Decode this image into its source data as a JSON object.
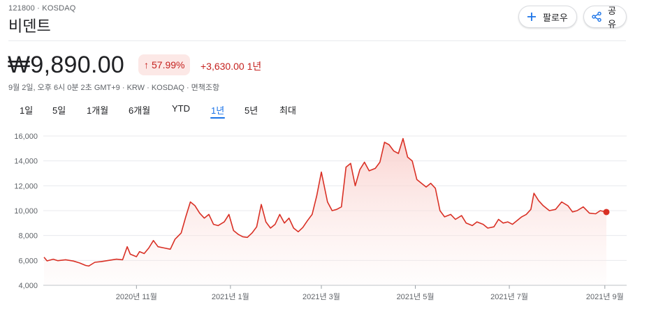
{
  "header": {
    "ticker": "121800 · KOSDAQ",
    "name": "비덴트",
    "follow_label": "팔로우",
    "share_label": "공유",
    "follow_icon": "plus-icon",
    "share_icon": "share-icon"
  },
  "quote": {
    "price": "₩9,890.00",
    "pct_change": "57.99%",
    "abs_change": "+3,630.00",
    "period": "1년",
    "meta": "9월 2일, 오후 6시 0분 2초 GMT+9 · KRW · KOSDAQ · 면책조항"
  },
  "tabs": [
    {
      "label": "1일",
      "active": false
    },
    {
      "label": "5일",
      "active": false
    },
    {
      "label": "1개월",
      "active": false
    },
    {
      "label": "6개월",
      "active": false
    },
    {
      "label": "YTD",
      "active": false
    },
    {
      "label": "1년",
      "active": true
    },
    {
      "label": "5년",
      "active": false
    },
    {
      "label": "최대",
      "active": false
    }
  ],
  "colors": {
    "line": "#d93025",
    "fill_top": "#fad2cf",
    "negative": "#c5221f",
    "accent": "#1a73e8",
    "grid": "#e8eaed"
  },
  "chart_data": {
    "type": "area",
    "title": "",
    "xlabel": "",
    "ylabel": "",
    "ylim": [
      4000,
      16000
    ],
    "yticks": [
      4000,
      6000,
      8000,
      10000,
      12000,
      14000,
      16000
    ],
    "ytick_labels": [
      "4,000",
      "6,000",
      "8,000",
      "10,000",
      "12,000",
      "14,000",
      "16,000"
    ],
    "xlim": [
      "2020-09-02",
      "2021-09-02"
    ],
    "xticks": [
      {
        "date": "2020-11-01",
        "label": "2020년 11월"
      },
      {
        "date": "2021-01-01",
        "label": "2021년 1월"
      },
      {
        "date": "2021-03-01",
        "label": "2021년 3월"
      },
      {
        "date": "2021-05-01",
        "label": "2021년 5월"
      },
      {
        "date": "2021-07-01",
        "label": "2021년 7월"
      },
      {
        "date": "2021-09-01",
        "label": "2021년 9월"
      }
    ],
    "grid": "horizontal",
    "series": [
      {
        "values": [
          {
            "x": "2020-09-02",
            "y": 6260
          },
          {
            "x": "2020-09-04",
            "y": 5960
          },
          {
            "x": "2020-09-08",
            "y": 6100
          },
          {
            "x": "2020-09-11",
            "y": 5980
          },
          {
            "x": "2020-09-16",
            "y": 6050
          },
          {
            "x": "2020-09-21",
            "y": 5950
          },
          {
            "x": "2020-09-25",
            "y": 5800
          },
          {
            "x": "2020-09-29",
            "y": 5600
          },
          {
            "x": "2020-10-01",
            "y": 5550
          },
          {
            "x": "2020-10-05",
            "y": 5850
          },
          {
            "x": "2020-10-09",
            "y": 5900
          },
          {
            "x": "2020-10-14",
            "y": 6000
          },
          {
            "x": "2020-10-19",
            "y": 6100
          },
          {
            "x": "2020-10-23",
            "y": 6050
          },
          {
            "x": "2020-10-26",
            "y": 7100
          },
          {
            "x": "2020-10-28",
            "y": 6500
          },
          {
            "x": "2020-11-01",
            "y": 6300
          },
          {
            "x": "2020-11-03",
            "y": 6700
          },
          {
            "x": "2020-11-06",
            "y": 6550
          },
          {
            "x": "2020-11-09",
            "y": 7000
          },
          {
            "x": "2020-11-12",
            "y": 7600
          },
          {
            "x": "2020-11-15",
            "y": 7100
          },
          {
            "x": "2020-11-19",
            "y": 7000
          },
          {
            "x": "2020-11-23",
            "y": 6900
          },
          {
            "x": "2020-11-26",
            "y": 7700
          },
          {
            "x": "2020-11-30",
            "y": 8200
          },
          {
            "x": "2020-12-03",
            "y": 9500
          },
          {
            "x": "2020-12-06",
            "y": 10700
          },
          {
            "x": "2020-12-09",
            "y": 10400
          },
          {
            "x": "2020-12-12",
            "y": 9800
          },
          {
            "x": "2020-12-15",
            "y": 9400
          },
          {
            "x": "2020-12-18",
            "y": 9700
          },
          {
            "x": "2020-12-21",
            "y": 8900
          },
          {
            "x": "2020-12-24",
            "y": 8800
          },
          {
            "x": "2020-12-28",
            "y": 9100
          },
          {
            "x": "2020-12-31",
            "y": 9700
          },
          {
            "x": "2021-01-03",
            "y": 8400
          },
          {
            "x": "2021-01-06",
            "y": 8100
          },
          {
            "x": "2021-01-09",
            "y": 7900
          },
          {
            "x": "2021-01-12",
            "y": 7850
          },
          {
            "x": "2021-01-15",
            "y": 8200
          },
          {
            "x": "2021-01-18",
            "y": 8700
          },
          {
            "x": "2021-01-21",
            "y": 10500
          },
          {
            "x": "2021-01-24",
            "y": 9100
          },
          {
            "x": "2021-01-27",
            "y": 8600
          },
          {
            "x": "2021-01-30",
            "y": 8900
          },
          {
            "x": "2021-02-02",
            "y": 9700
          },
          {
            "x": "2021-02-05",
            "y": 9000
          },
          {
            "x": "2021-02-08",
            "y": 9400
          },
          {
            "x": "2021-02-11",
            "y": 8600
          },
          {
            "x": "2021-02-14",
            "y": 8300
          },
          {
            "x": "2021-02-17",
            "y": 8650
          },
          {
            "x": "2021-02-20",
            "y": 9200
          },
          {
            "x": "2021-02-23",
            "y": 9700
          },
          {
            "x": "2021-02-26",
            "y": 11200
          },
          {
            "x": "2021-03-01",
            "y": 13100
          },
          {
            "x": "2021-03-03",
            "y": 11900
          },
          {
            "x": "2021-03-05",
            "y": 10700
          },
          {
            "x": "2021-03-08",
            "y": 10000
          },
          {
            "x": "2021-03-11",
            "y": 10100
          },
          {
            "x": "2021-03-14",
            "y": 10300
          },
          {
            "x": "2021-03-17",
            "y": 13500
          },
          {
            "x": "2021-03-20",
            "y": 13800
          },
          {
            "x": "2021-03-23",
            "y": 12000
          },
          {
            "x": "2021-03-26",
            "y": 13300
          },
          {
            "x": "2021-03-29",
            "y": 13900
          },
          {
            "x": "2021-04-01",
            "y": 13200
          },
          {
            "x": "2021-04-05",
            "y": 13400
          },
          {
            "x": "2021-04-08",
            "y": 13900
          },
          {
            "x": "2021-04-11",
            "y": 15500
          },
          {
            "x": "2021-04-14",
            "y": 15300
          },
          {
            "x": "2021-04-17",
            "y": 14800
          },
          {
            "x": "2021-04-20",
            "y": 14600
          },
          {
            "x": "2021-04-23",
            "y": 15800
          },
          {
            "x": "2021-04-26",
            "y": 14300
          },
          {
            "x": "2021-04-29",
            "y": 14000
          },
          {
            "x": "2021-05-02",
            "y": 12500
          },
          {
            "x": "2021-05-05",
            "y": 12200
          },
          {
            "x": "2021-05-08",
            "y": 11900
          },
          {
            "x": "2021-05-11",
            "y": 12200
          },
          {
            "x": "2021-05-14",
            "y": 11800
          },
          {
            "x": "2021-05-17",
            "y": 10000
          },
          {
            "x": "2021-05-20",
            "y": 9500
          },
          {
            "x": "2021-05-24",
            "y": 9700
          },
          {
            "x": "2021-05-27",
            "y": 9300
          },
          {
            "x": "2021-05-31",
            "y": 9600
          },
          {
            "x": "2021-06-03",
            "y": 9000
          },
          {
            "x": "2021-06-07",
            "y": 8800
          },
          {
            "x": "2021-06-10",
            "y": 9100
          },
          {
            "x": "2021-06-14",
            "y": 8900
          },
          {
            "x": "2021-06-17",
            "y": 8600
          },
          {
            "x": "2021-06-21",
            "y": 8700
          },
          {
            "x": "2021-06-24",
            "y": 9300
          },
          {
            "x": "2021-06-27",
            "y": 9000
          },
          {
            "x": "2021-06-30",
            "y": 9100
          },
          {
            "x": "2021-07-03",
            "y": 8900
          },
          {
            "x": "2021-07-06",
            "y": 9200
          },
          {
            "x": "2021-07-09",
            "y": 9500
          },
          {
            "x": "2021-07-12",
            "y": 9700
          },
          {
            "x": "2021-07-15",
            "y": 10100
          },
          {
            "x": "2021-07-17",
            "y": 11400
          },
          {
            "x": "2021-07-20",
            "y": 10800
          },
          {
            "x": "2021-07-23",
            "y": 10400
          },
          {
            "x": "2021-07-27",
            "y": 10000
          },
          {
            "x": "2021-07-31",
            "y": 10100
          },
          {
            "x": "2021-08-04",
            "y": 10700
          },
          {
            "x": "2021-08-08",
            "y": 10400
          },
          {
            "x": "2021-08-11",
            "y": 9900
          },
          {
            "x": "2021-08-14",
            "y": 10000
          },
          {
            "x": "2021-08-18",
            "y": 10300
          },
          {
            "x": "2021-08-22",
            "y": 9800
          },
          {
            "x": "2021-08-26",
            "y": 9750
          },
          {
            "x": "2021-08-29",
            "y": 10000
          },
          {
            "x": "2021-09-02",
            "y": 9890
          }
        ]
      }
    ],
    "last_value": 9890
  }
}
